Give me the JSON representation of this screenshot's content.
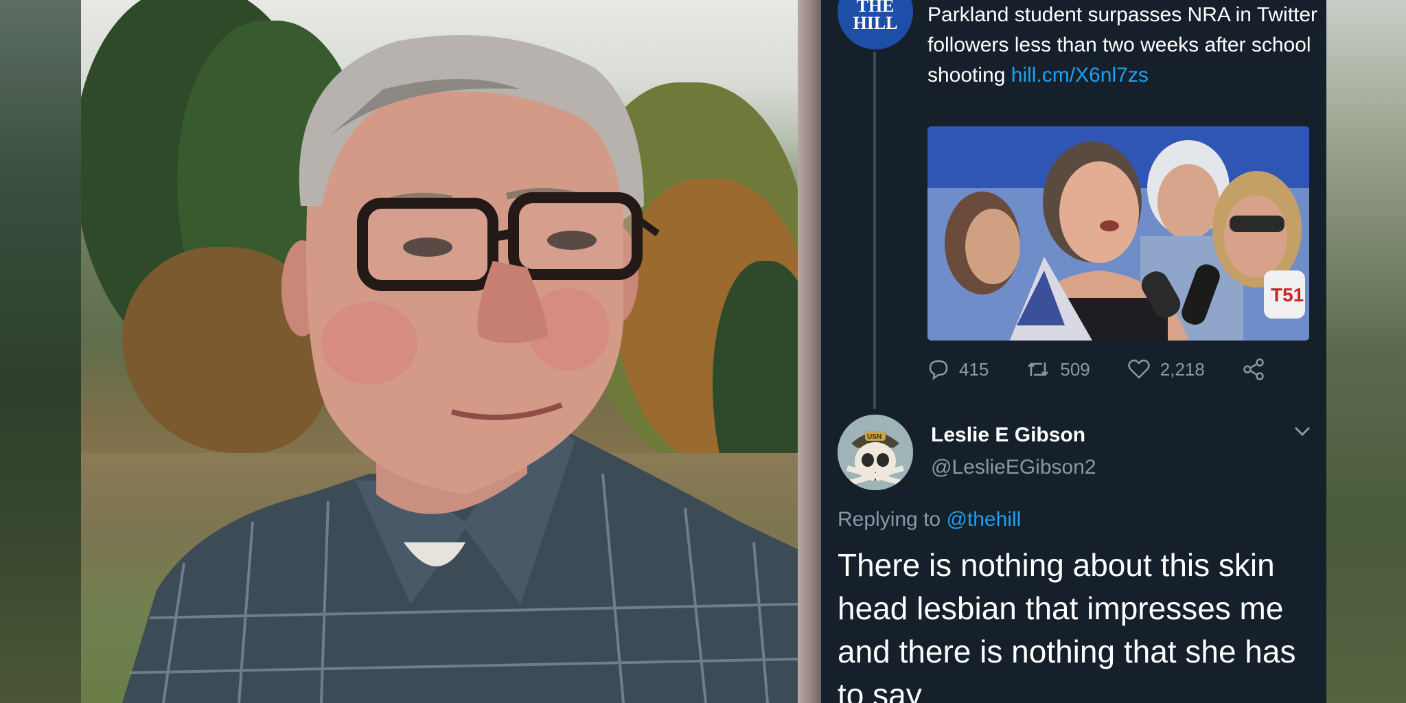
{
  "quoted_tweet": {
    "author_avatar_text": [
      "THE",
      "HILL"
    ],
    "text_prefix": "Parkland student surpasses NRA in Twitter followers less than two weeks after school shooting ",
    "link_text": "hill.cm/X6nl7zs",
    "media_description_icon": "photo-protest-microphones",
    "media_badge_text": "T51",
    "stats": {
      "replies": "415",
      "retweets": "509",
      "likes": "2,218"
    }
  },
  "reply": {
    "display_name": "Leslie E Gibson",
    "handle": "@LeslieEGibson2",
    "avatar_badge_text": "USN",
    "replying_label": "Replying to ",
    "replying_to": "@thehill",
    "body": "There is nothing about this skin head lesbian that impresses me and there is nothing that she has to say"
  },
  "colors": {
    "panel_bg": "#15202b",
    "link_blue": "#1da1f2",
    "muted_gray": "#8899a6",
    "hill_blue": "#1d4fa8"
  }
}
